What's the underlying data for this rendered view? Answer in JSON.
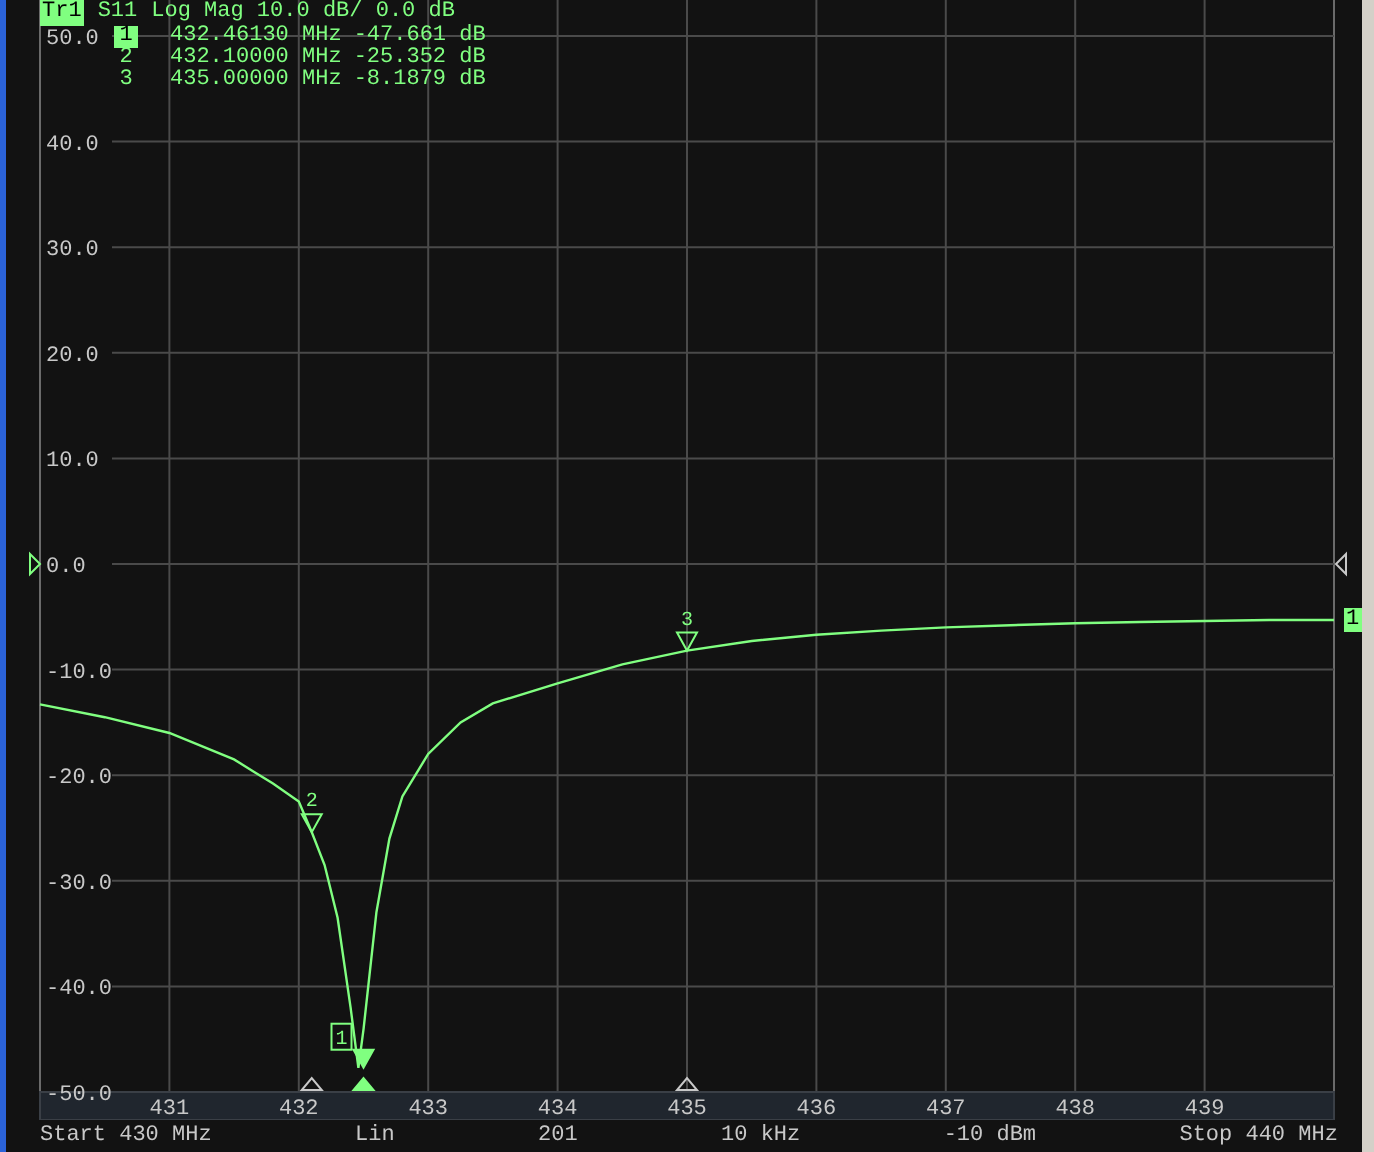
{
  "trace": {
    "badge": "Tr1",
    "title": "Log Mag 10.0 dB/ 0.0 dB",
    "end_label": "1"
  },
  "readout": [
    {
      "number": "1",
      "frequency": "432.46130 MHz",
      "value": "-47.661 dB",
      "selected": true
    },
    {
      "number": "2",
      "frequency": "432.10000 MHz",
      "value": "-25.352 dB",
      "selected": false
    },
    {
      "number": "3",
      "frequency": "435.00000 MHz",
      "value": "-8.1879 dB",
      "selected": false
    }
  ],
  "chart_data": {
    "type": "line",
    "grid": true,
    "xlim": [
      430,
      440
    ],
    "ylim": [
      -50,
      50
    ],
    "xticks": [
      431,
      432,
      433,
      434,
      435,
      436,
      437,
      438,
      439
    ],
    "yticks": [
      {
        "value": 50,
        "label": "50.0"
      },
      {
        "value": 40,
        "label": "40.0"
      },
      {
        "value": 30,
        "label": "30.0"
      },
      {
        "value": 20,
        "label": "20.0"
      },
      {
        "value": 10,
        "label": "10.0"
      },
      {
        "value": 0,
        "label": "0.0"
      },
      {
        "value": -10,
        "label": "-10.0"
      },
      {
        "value": -20,
        "label": "-20.0"
      },
      {
        "value": -30,
        "label": "-30.0"
      },
      {
        "value": -40,
        "label": "-40.0"
      },
      {
        "value": -50,
        "label": "-50.0"
      }
    ],
    "x": [
      430,
      430.5,
      431,
      431.5,
      431.8,
      432,
      432.1,
      432.2,
      432.3,
      432.4,
      432.46,
      432.5,
      432.6,
      432.7,
      432.8,
      433,
      433.25,
      433.5,
      434,
      434.5,
      435,
      435.5,
      436,
      436.5,
      437,
      437.5,
      438,
      438.5,
      439,
      439.5,
      440
    ],
    "series": [
      {
        "name": "S11",
        "color": "#80ff80",
        "values": [
          -13.3,
          -14.5,
          -16.0,
          -18.5,
          -20.8,
          -22.5,
          -25.4,
          -28.5,
          -33.5,
          -42,
          -47.7,
          -44,
          -33,
          -26,
          -22,
          -18,
          -15,
          -13.2,
          -11.3,
          -9.5,
          -8.2,
          -7.3,
          -6.7,
          -6.3,
          -6.0,
          -5.8,
          -5.6,
          -5.5,
          -5.4,
          -5.3,
          -5.3
        ]
      }
    ],
    "annotations": [
      {
        "x": 432.5,
        "y": -47.7,
        "text": "1"
      },
      {
        "x": 432.1,
        "y": -25.4,
        "text": "2"
      },
      {
        "x": 435,
        "y": -8.2,
        "text": "3"
      }
    ]
  },
  "status_bar": [
    "Start 430 MHz",
    "Lin",
    "201",
    "10 kHz",
    "-10 dBm",
    "Stop 440 MHz"
  ]
}
